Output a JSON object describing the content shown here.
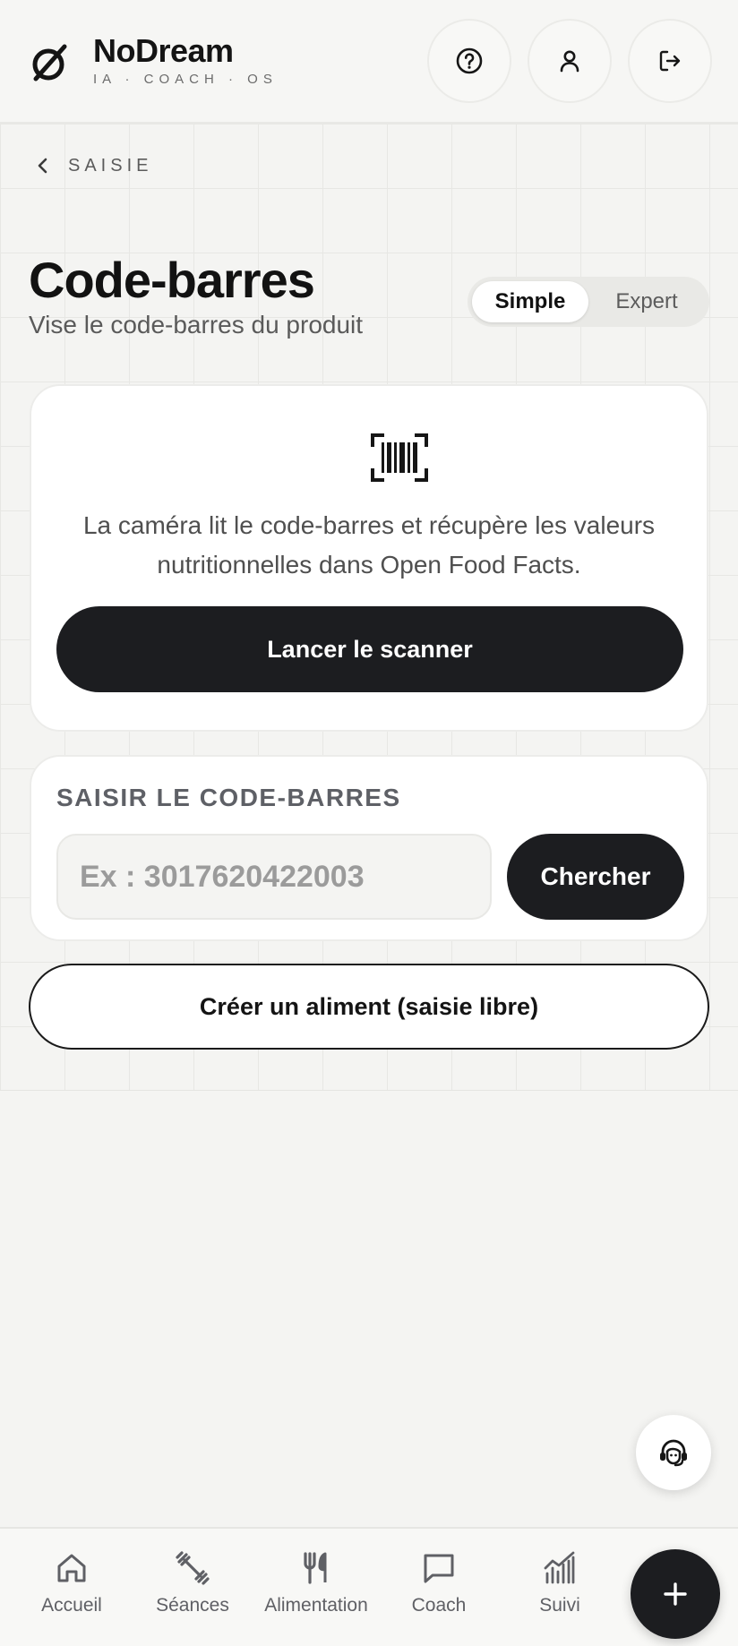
{
  "brand": {
    "name": "NoDream",
    "tagline": "IA · COACH · OS"
  },
  "header": {
    "buttons": [
      {
        "icon": "help-icon"
      },
      {
        "icon": "user-icon"
      },
      {
        "icon": "logout-icon"
      }
    ]
  },
  "breadcrumb": {
    "back_label": "SAISIE"
  },
  "page": {
    "title": "Code-barres",
    "subtitle": "Vise le code-barres du produit"
  },
  "mode_toggle": {
    "options": [
      "Simple",
      "Expert"
    ],
    "selected": "Simple"
  },
  "scan_card": {
    "icon": "barcode-scan-icon",
    "description": "La caméra lit le code-barres et récupère les valeurs nutritionnelles dans Open Food Facts.",
    "button_label": "Lancer le scanner"
  },
  "manual_entry": {
    "section_label": "SAISIR LE CODE-BARRES",
    "input_value": "",
    "input_placeholder": "Ex : 3017620422003",
    "search_label": "Chercher"
  },
  "create_food": {
    "label": "Créer un aliment (saisie libre)"
  },
  "bottom_nav": {
    "items": [
      {
        "label": "Accueil",
        "icon": "home-icon"
      },
      {
        "label": "Séances",
        "icon": "dumbbell-icon"
      },
      {
        "label": "Alimentation",
        "icon": "fork-knife-icon"
      },
      {
        "label": "Coach",
        "icon": "chat-icon"
      },
      {
        "label": "Suivi",
        "icon": "chart-icon"
      }
    ]
  },
  "colors": {
    "accent_dark": "#1c1d20",
    "background": "#f4f4f2",
    "card": "#ffffff"
  }
}
